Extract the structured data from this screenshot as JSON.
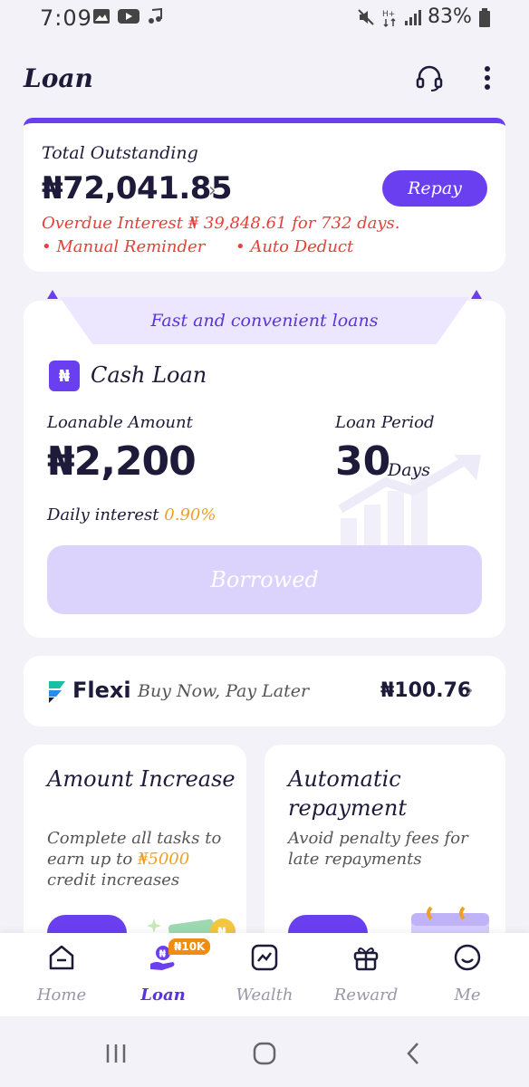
{
  "status_bar": {
    "time": "7:09",
    "battery": "83%"
  },
  "header": {
    "title": "Loan",
    "support_icon": "headset-icon",
    "more_icon": "more-vertical-icon"
  },
  "outstanding": {
    "label": "Total Outstanding",
    "amount": "₦72,041.85",
    "repay_label": "Repay",
    "overdue_text": "Overdue Interest ₦ 39,848.61 for 732 days.",
    "reminder_1": "• Manual Reminder",
    "reminder_2": "• Auto Deduct"
  },
  "cash_loan": {
    "banner": "Fast and convenient loans",
    "title": "Cash Loan",
    "loanable_label": "Loanable Amount",
    "loanable_amount": "₦2,200",
    "period_label": "Loan Period",
    "period_value": "30",
    "period_unit": "Days",
    "daily_label": "Daily interest",
    "daily_value": "0.90%",
    "button_label": "Borrowed"
  },
  "flexi": {
    "name": "Flexi",
    "tagline": "Buy Now, Pay Later",
    "amount": "₦100.76"
  },
  "promos": [
    {
      "title": "Amount Increase",
      "desc_pre": "Complete all tasks to earn up to ",
      "desc_highlight": "₦5000",
      "desc_post": " credit increases"
    },
    {
      "title": "Automatic repayment",
      "desc_pre": "Avoid penalty fees for late repayments",
      "desc_highlight": "",
      "desc_post": ""
    }
  ],
  "bottom_nav": [
    {
      "label": "Home",
      "icon": "home-icon"
    },
    {
      "label": "Loan",
      "icon": "loan-icon",
      "badge": "₦10K"
    },
    {
      "label": "Wealth",
      "icon": "wealth-icon"
    },
    {
      "label": "Reward",
      "icon": "gift-icon"
    },
    {
      "label": "Me",
      "icon": "smiley-icon"
    }
  ],
  "colors": {
    "primary": "#6a3ff0",
    "danger": "#e5403a",
    "highlight": "#f0a020",
    "background": "#f3f2f8"
  }
}
